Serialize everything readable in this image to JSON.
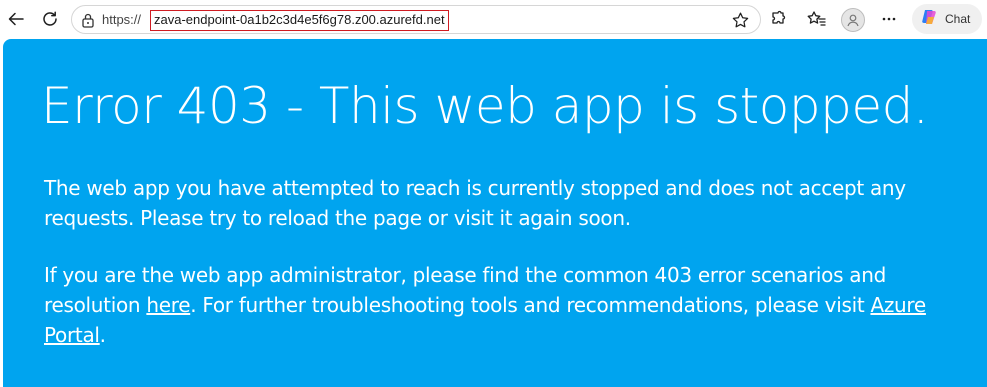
{
  "browser": {
    "url_scheme": "https://",
    "url_host": "zava-endpoint-0a1b2c3d4e5f6g78.z00.azurefd.net",
    "chat_label": "Chat",
    "icons": [
      "back-arrow-icon",
      "refresh-icon",
      "lock-icon",
      "star-icon",
      "extensions-icon",
      "favorites-icon",
      "profile-icon",
      "more-icon",
      "copilot-icon"
    ]
  },
  "page": {
    "background_color": "#00a4ef",
    "heading": "Error 403 - This web app is stopped.",
    "paragraph1": "The web app you have attempted to reach is currently stopped and does not accept any requests. Please try to reload the page or visit it again soon.",
    "paragraph2_part1": "If you are the web app administrator, please find the common 403 error scenarios and resolution ",
    "paragraph2_link1": "here",
    "paragraph2_part2": ". For further troubleshooting tools and recommendations, please visit ",
    "paragraph2_link2": "Azure Portal",
    "paragraph2_part3": "."
  }
}
